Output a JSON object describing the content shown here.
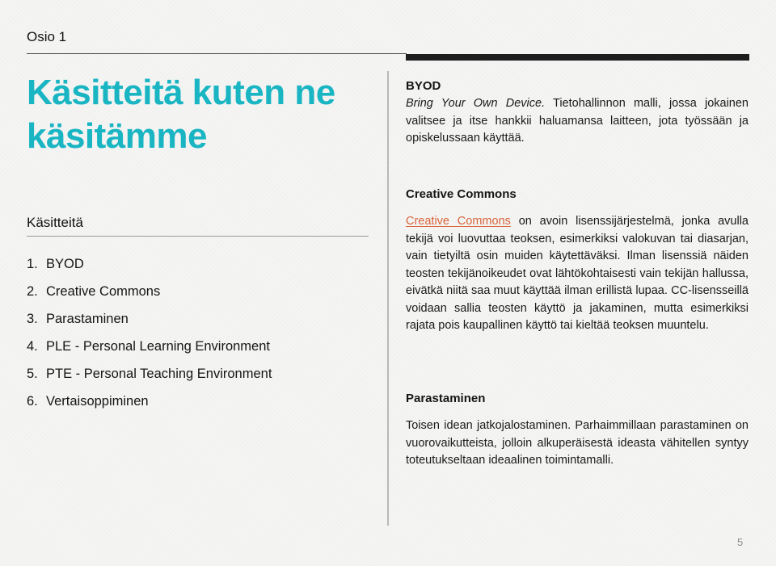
{
  "header": {
    "section_label": "Osio 1"
  },
  "main_title": "Käsitteitä kuten ne käsitämme",
  "toc": {
    "heading": "Käsitteitä",
    "items": [
      {
        "number": "1.",
        "label": "BYOD"
      },
      {
        "number": "2.",
        "label": "Creative Commons"
      },
      {
        "number": "3.",
        "label": "Parastaminen"
      },
      {
        "number": "4.",
        "label": "PLE - Personal Learning Environment"
      },
      {
        "number": "5.",
        "label": "PTE - Personal Teaching Environment"
      },
      {
        "number": "6.",
        "label": "Vertaisoppiminen"
      }
    ]
  },
  "sections": {
    "byod": {
      "heading": "BYOD",
      "italic_lead": "Bring Your Own Device.",
      "text": " Tietohallinnon malli, jossa jokainen valitsee ja itse hankkii haluamansa laitteen, jota työssään ja opiskelussaan käyttää."
    },
    "creative_commons": {
      "heading": "Creative Commons",
      "link_text": "Creative Commons",
      "link_color": "#d9643a",
      "text": " on avoin lisenssijärjestelmä, jonka avulla tekijä voi luovuttaa teoksen, esimerkiksi valokuvan tai diasarjan, vain tietyiltä osin muiden käytettäväksi. Ilman lisenssiä näiden teosten tekijänoikeudet ovat lähtökohtaisesti vain tekijän hallussa, eivätkä niitä saa muut käyttää ilman erillistä lupaa. CC-lisensseillä voidaan sallia teosten käyttö ja jakaminen, mutta esimerkiksi rajata pois kaupallinen käyttö tai kieltää teoksen muuntelu."
    },
    "parastaminen": {
      "heading": "Parastaminen",
      "text": "Toisen idean jatkojalostaminen. Parhaimmillaan parastaminen on vuorovaikutteista, jolloin alkuperäisestä ideasta vähitellen syntyy toteutukseltaan ideaalinen toimintamalli."
    }
  },
  "colors": {
    "title_accent": "#19b5c3",
    "link": "#d9643a"
  },
  "footer": {
    "page_number": "5"
  }
}
